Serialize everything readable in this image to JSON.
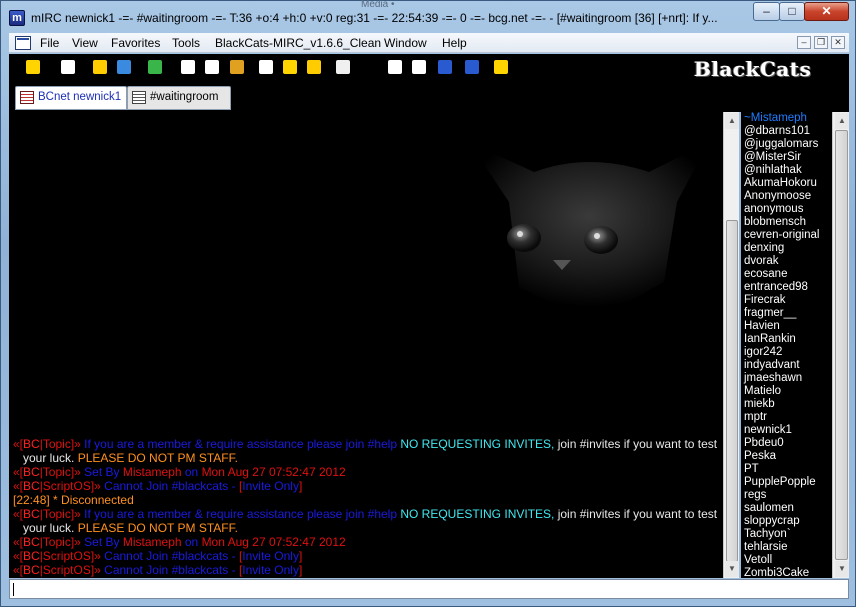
{
  "window": {
    "title": "mIRC newnick1 -=- #waitingroom -=- T:36 +o:4 +h:0 +v:0 reg:31 -=- 22:54:39 -=- 0 -=- bcg.net -=- - [#waitingroom [36] [+nrt]: If y...",
    "ghost_tab": "Media •",
    "app_icon": "mIRC",
    "minimize": "–",
    "maximize": "□",
    "close": "✕"
  },
  "menu": {
    "items": [
      "File",
      "View",
      "Favorites",
      "Tools",
      "BlackCats-MIRC_v1.6.6_Clean",
      "Window",
      "Help"
    ],
    "mdi_minimize": "–",
    "mdi_restore": "❐",
    "mdi_close": "✕"
  },
  "toolbar": {
    "icons": [
      "connect-icon",
      "options-icon",
      "channels-icon",
      "scripts-icon",
      "address-book-icon",
      "notify-icon",
      "timer-icon",
      "colors-icon",
      "script-editor-icon",
      "dcc-send-icon",
      "dcc-chat-icon",
      "notes-icon",
      "ignore-icon",
      "url-icon",
      "tile-icon",
      "cascade-icon",
      "away-icon"
    ],
    "icon_colors": [
      "#ffd400",
      "#ffffff",
      "#ffcc00",
      "#3a8ae0",
      "#39b54a",
      "#ffffff",
      "#ffffff",
      "#e0a020",
      "#ffffff",
      "#ffd400",
      "#ffcc00",
      "#f0f0f0",
      "#ffffff",
      "#ffffff",
      "#2a5ad0",
      "#2a5ad0",
      "#ffd400"
    ],
    "brand": "BlackCats"
  },
  "tabs": [
    {
      "label": "BCnet newnick1",
      "active": true
    },
    {
      "label": "#waitingroom",
      "active": false
    }
  ],
  "chat": {
    "lines": [
      {
        "wrap": true,
        "segs": [
          {
            "t": "«[",
            "c": "c-red"
          },
          {
            "t": "BC",
            "c": "c-fire"
          },
          {
            "t": "|",
            "c": "c-red"
          },
          {
            "t": "Topic",
            "c": "c-red"
          },
          {
            "t": "]» ",
            "c": "c-red"
          },
          {
            "t": "If you are a member & require assistance please join #help ",
            "c": "c-blue"
          },
          {
            "t": "NO REQUESTING INVITES,",
            "c": "c-cyan"
          },
          {
            "t": " join #invites if you want to test your luck. ",
            "c": "c-white"
          },
          {
            "t": "PLEASE DO NOT PM STAFF.",
            "c": "c-orange"
          }
        ]
      },
      {
        "segs": [
          {
            "t": "«[",
            "c": "c-red"
          },
          {
            "t": "BC",
            "c": "c-fire"
          },
          {
            "t": "|Topic]» ",
            "c": "c-red"
          },
          {
            "t": "Set By ",
            "c": "c-blue"
          },
          {
            "t": "Mistameph",
            "c": "c-red"
          },
          {
            "t": " on ",
            "c": "c-blue"
          },
          {
            "t": "Mon Aug 27 07:52:47 2012",
            "c": "c-red"
          }
        ]
      },
      {
        "segs": [
          {
            "t": "«[",
            "c": "c-red"
          },
          {
            "t": "BC",
            "c": "c-fire"
          },
          {
            "t": "|ScriptOS]» ",
            "c": "c-red"
          },
          {
            "t": "Cannot Join ",
            "c": "c-blue"
          },
          {
            "t": "#blackcats",
            "c": "c-blue"
          },
          {
            "t": " - ",
            "c": "c-blue"
          },
          {
            "t": "[",
            "c": "c-red"
          },
          {
            "t": "Invite Only",
            "c": "c-blue"
          },
          {
            "t": "]",
            "c": "c-red"
          }
        ]
      },
      {
        "segs": [
          {
            "t": "[22:48] * Disconnected",
            "c": "c-orange"
          }
        ]
      },
      {
        "wrap": true,
        "segs": [
          {
            "t": "«[",
            "c": "c-red"
          },
          {
            "t": "BC",
            "c": "c-fire"
          },
          {
            "t": "|",
            "c": "c-red"
          },
          {
            "t": "Topic",
            "c": "c-red"
          },
          {
            "t": "]» ",
            "c": "c-red"
          },
          {
            "t": "If you are a member & require assistance please join #help ",
            "c": "c-blue"
          },
          {
            "t": "NO REQUESTING INVITES,",
            "c": "c-cyan"
          },
          {
            "t": " join #invites if you want to test your luck. ",
            "c": "c-white"
          },
          {
            "t": "PLEASE DO NOT PM STAFF.",
            "c": "c-orange"
          }
        ]
      },
      {
        "segs": [
          {
            "t": "«[",
            "c": "c-red"
          },
          {
            "t": "BC",
            "c": "c-fire"
          },
          {
            "t": "|Topic]» ",
            "c": "c-red"
          },
          {
            "t": "Set By ",
            "c": "c-blue"
          },
          {
            "t": "Mistameph",
            "c": "c-red"
          },
          {
            "t": " on ",
            "c": "c-blue"
          },
          {
            "t": "Mon Aug 27 07:52:47 2012",
            "c": "c-red"
          }
        ]
      },
      {
        "segs": [
          {
            "t": "«[",
            "c": "c-red"
          },
          {
            "t": "BC",
            "c": "c-fire"
          },
          {
            "t": "|ScriptOS]» ",
            "c": "c-red"
          },
          {
            "t": "Cannot Join ",
            "c": "c-blue"
          },
          {
            "t": "#blackcats",
            "c": "c-blue"
          },
          {
            "t": " - ",
            "c": "c-blue"
          },
          {
            "t": "[",
            "c": "c-red"
          },
          {
            "t": "Invite Only",
            "c": "c-blue"
          },
          {
            "t": "]",
            "c": "c-red"
          }
        ]
      },
      {
        "segs": [
          {
            "t": "«[",
            "c": "c-red"
          },
          {
            "t": "BC",
            "c": "c-fire"
          },
          {
            "t": "|ScriptOS]» ",
            "c": "c-red"
          },
          {
            "t": "Cannot Join ",
            "c": "c-blue"
          },
          {
            "t": "#blackcats",
            "c": "c-blue"
          },
          {
            "t": " - ",
            "c": "c-blue"
          },
          {
            "t": "[",
            "c": "c-red"
          },
          {
            "t": "Invite Only",
            "c": "c-blue"
          },
          {
            "t": "]",
            "c": "c-red"
          }
        ]
      }
    ]
  },
  "nicklist": [
    "~Mistameph",
    "@dbarns101",
    "@juggalomars",
    "@MisterSir",
    "@nihlathak",
    "AkumaHokoru",
    "Anonymoose",
    "anonymous",
    "blobmensch",
    "cevren-original",
    "denxing",
    "dvorak",
    "ecosane",
    "entranced98",
    "Firecrak",
    "fragmer__",
    "Havien",
    "IanRankin",
    "igor242",
    "indyadvant",
    "jmaeshawn",
    "Matielo",
    "miekb",
    "mptr",
    "newnick1",
    "Pbdeu0",
    "Peska",
    "PT",
    "PupplePopple",
    "regs",
    "saulomen",
    "sloppycrap",
    "Tachyon`",
    "tehlarsie",
    "Vetoll",
    "Zombi3Cake"
  ],
  "editbox": {
    "value": ""
  }
}
